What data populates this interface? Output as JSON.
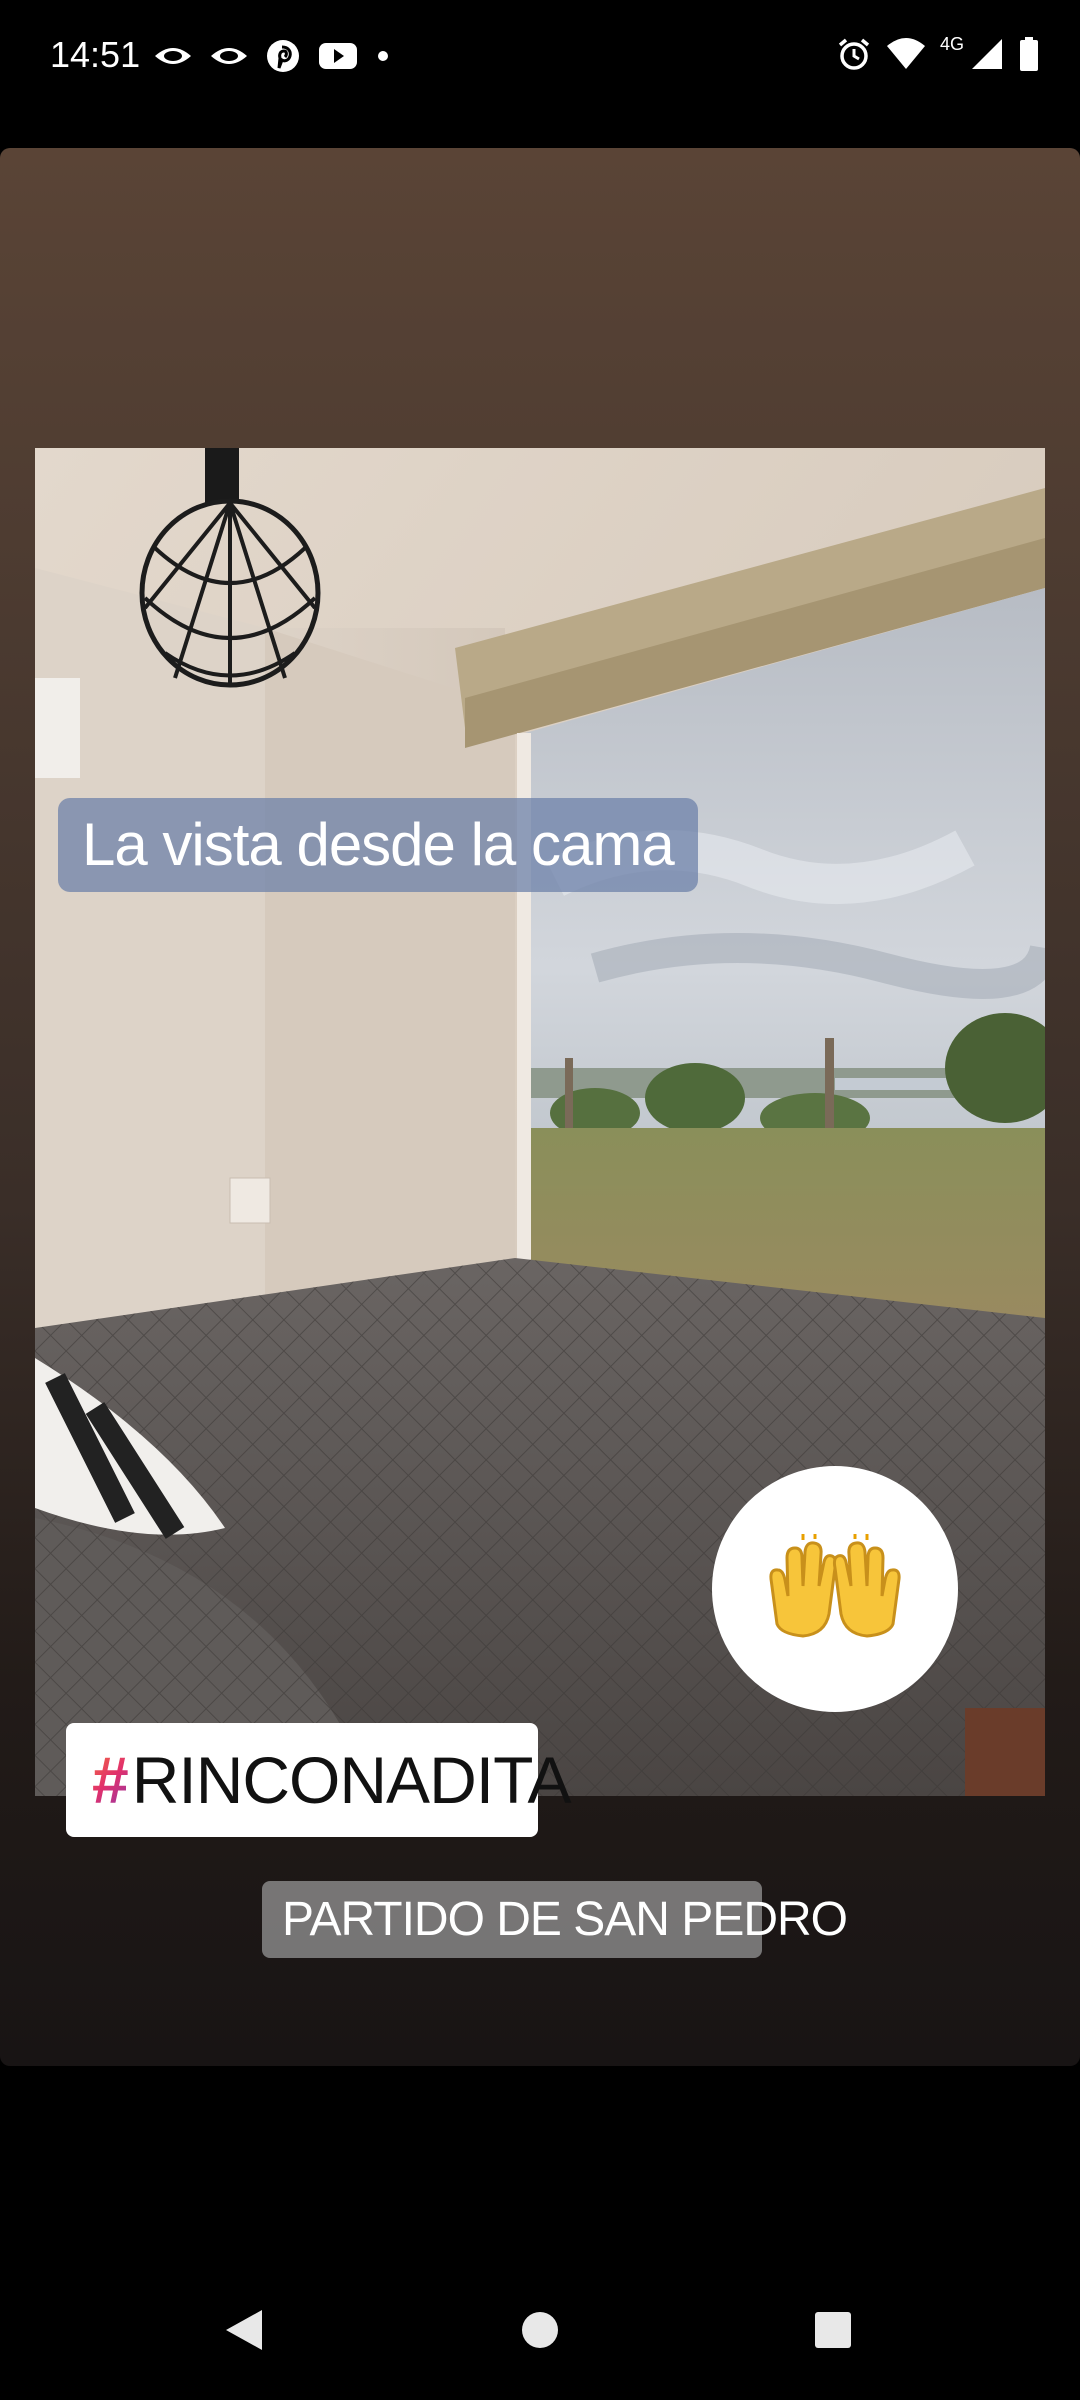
{
  "status_bar": {
    "time": "14:51",
    "network_type": "4G",
    "left_icons": [
      "eye-icon",
      "eye-icon",
      "pinterest-icon",
      "youtube-icon",
      "dot-icon"
    ],
    "right_icons": [
      "alarm-icon",
      "wifi-icon",
      "signal-icon",
      "battery-icon"
    ]
  },
  "story": {
    "caption": "La vista desde la cama",
    "emoji": "🙌",
    "hashtag": "RINCONADITA",
    "hashtag_symbol": "#",
    "location": "PARTIDO DE SAN PEDRO"
  },
  "nav_bar": {
    "buttons": [
      "back-icon",
      "home-icon",
      "recents-icon"
    ]
  }
}
